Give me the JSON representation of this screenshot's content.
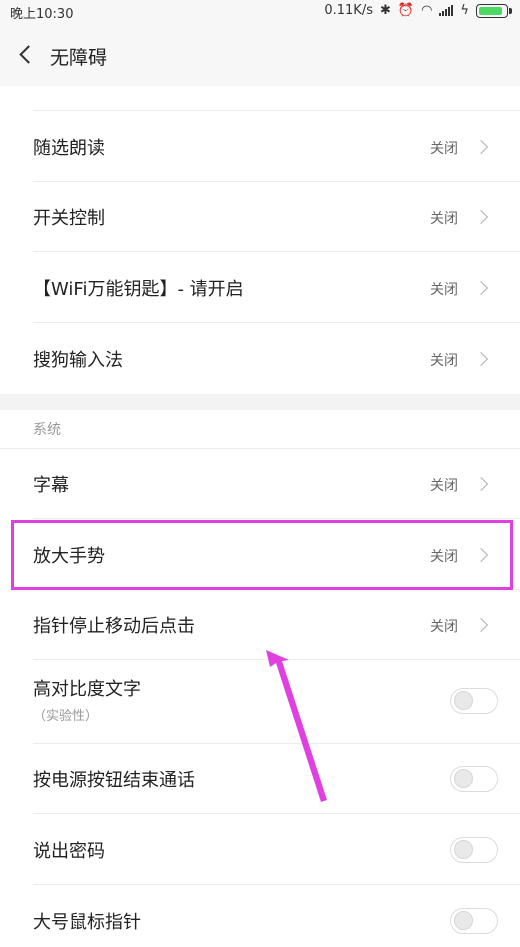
{
  "status": {
    "time": "晚上10:30",
    "speed": "0.11K/s",
    "bluetooth_icon": "bluetooth-icon",
    "alarm_icon": "alarm-icon",
    "wifi_icon": "wifi-icon",
    "signal_icon": "signal-icon",
    "battery_icon": "battery-charging-icon",
    "battery_level": 0.9
  },
  "header": {
    "back_icon": "back-arrow-icon",
    "title": "无障碍"
  },
  "services": [
    {
      "label": "随选朗读",
      "value": "关闭"
    },
    {
      "label": "开关控制",
      "value": "关闭"
    },
    {
      "label": "【WiFi万能钥匙】- 请开启",
      "value": "关闭"
    },
    {
      "label": "搜狗输入法",
      "value": "关闭"
    }
  ],
  "system": {
    "section_label": "系统",
    "rows": [
      {
        "label": "字幕",
        "value": "关闭"
      },
      {
        "label": "放大手势",
        "value": "关闭"
      },
      {
        "label": "指针停止移动后点击",
        "value": "关闭"
      }
    ],
    "toggles": [
      {
        "label": "高对比度文字",
        "sub": "（实验性）",
        "on": false
      },
      {
        "label": "按电源按钮结束通话",
        "on": false
      },
      {
        "label": "说出密码",
        "on": false
      },
      {
        "label": "大号鼠标指针",
        "on": false
      }
    ]
  },
  "annotation": {
    "highlight_color": "#e040e0"
  }
}
